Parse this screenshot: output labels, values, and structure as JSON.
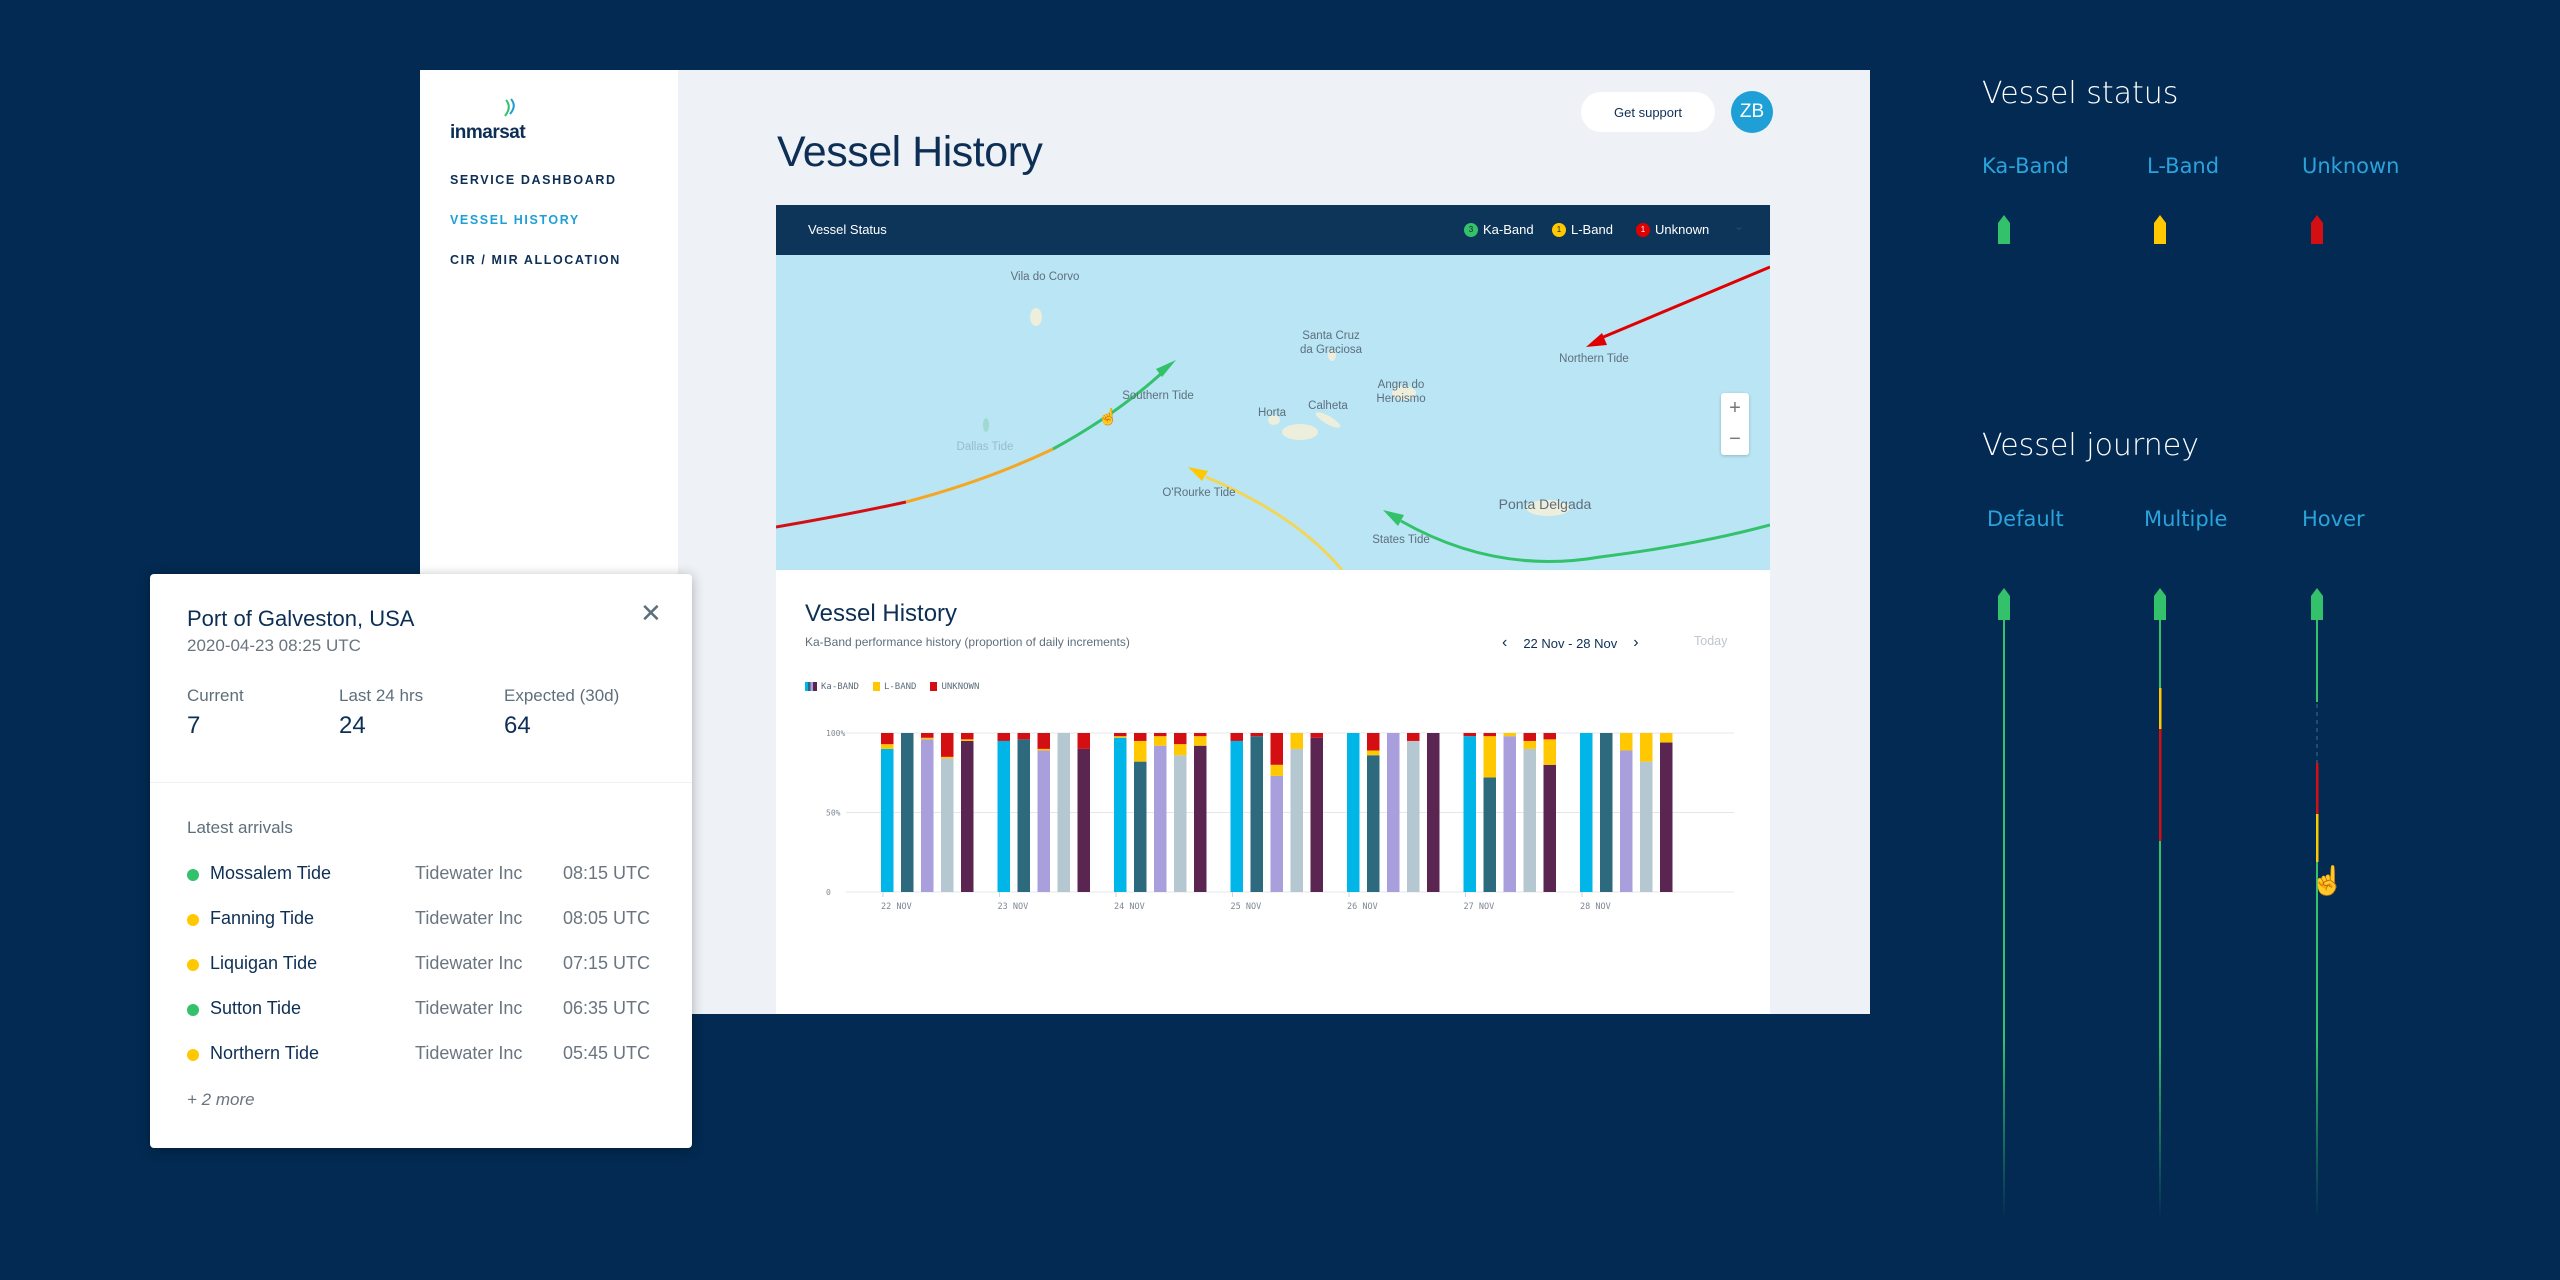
{
  "app": {
    "logo": "inmarsat",
    "nav": [
      {
        "label": "SERVICE DASHBOARD",
        "active": false
      },
      {
        "label": "VESSEL HISTORY",
        "active": true
      },
      {
        "label": "CIR / MIR ALLOCATION",
        "active": false
      }
    ],
    "support_label": "Get support",
    "avatar_initials": "ZB",
    "page_title": "Vessel History"
  },
  "map": {
    "header": "Vessel Status",
    "status": [
      {
        "label": "Ka-Band",
        "count": "3",
        "color": "#33c16b"
      },
      {
        "label": "L-Band",
        "count": "1",
        "color": "#ffc800"
      },
      {
        "label": "Unknown",
        "count": "1",
        "color": "#e00000"
      }
    ],
    "places": [
      "Vila do Corvo",
      "Santa Cruz",
      "da Graciosa",
      "Angra do",
      "Heroismo",
      "Calheta",
      "Horta",
      "Ponta Delgada"
    ],
    "vessels": [
      "Southern Tide",
      "Dallas Tide",
      "Northern Tide",
      "O'Rourke Tide",
      "States Tide"
    ],
    "zoom_in": "+",
    "zoom_out": "−"
  },
  "history": {
    "title": "Vessel History",
    "subtitle": "Ka-Band performance history (proportion of daily increments)",
    "range": "22 Nov - 28 Nov",
    "prev": "‹",
    "next": "›",
    "today": "Today",
    "legend": [
      "Ka-BAND",
      "L-BAND",
      "UNKNOWN"
    ]
  },
  "chart_data": {
    "type": "bar",
    "stacked": true,
    "categories": [
      "22 NOV",
      "23 NOV",
      "24 NOV",
      "25 NOV",
      "26 NOV",
      "27 NOV",
      "28 NOV"
    ],
    "yticks": [
      "100%",
      "50%",
      "0"
    ],
    "ylim": [
      0,
      100
    ],
    "grid": true,
    "band_colors": {
      "Ka-BAND": "vessel color",
      "L-BAND": "#ffc800",
      "UNKNOWN": "#d40f14"
    },
    "series": [
      {
        "name": "SOUTHERN TIDE",
        "color": "#00b5e8",
        "ka": [
          90,
          95,
          97,
          95,
          100,
          98,
          100
        ],
        "l": [
          3,
          0,
          1,
          0,
          0,
          0,
          0
        ],
        "unknown": [
          7,
          5,
          2,
          5,
          0,
          2,
          0
        ]
      },
      {
        "name": "O'ROURKE TIDE",
        "color": "#2d6a7d",
        "ka": [
          100,
          96,
          82,
          98,
          86,
          72,
          100
        ],
        "l": [
          0,
          0,
          13,
          0,
          3,
          26,
          0
        ],
        "unknown": [
          0,
          4,
          5,
          2,
          11,
          2,
          0
        ]
      },
      {
        "name": "STATES TIDE",
        "color": "#a89fdc",
        "ka": [
          96,
          89,
          92,
          73,
          100,
          98,
          89
        ],
        "l": [
          1,
          1,
          6,
          7,
          0,
          2,
          11
        ],
        "unknown": [
          3,
          10,
          2,
          20,
          0,
          0,
          0
        ]
      },
      {
        "name": "DALLAS TIDE",
        "color": "#b5c8d2",
        "ka": [
          84,
          100,
          86,
          90,
          95,
          90,
          82
        ],
        "l": [
          1,
          0,
          7,
          10,
          0,
          5,
          18
        ],
        "unknown": [
          15,
          0,
          7,
          0,
          5,
          5,
          0
        ]
      },
      {
        "name": "NORTHERN TIDE",
        "color": "#5a2550",
        "ka": [
          95,
          90,
          92,
          97,
          100,
          80,
          94
        ],
        "l": [
          1,
          0,
          6,
          0,
          0,
          16,
          6
        ],
        "unknown": [
          4,
          10,
          2,
          3,
          0,
          4,
          0
        ]
      }
    ]
  },
  "popup": {
    "title": "Port of Galveston, USA",
    "datetime": "2020-04-23 08:25 UTC",
    "stats": [
      {
        "label": "Current",
        "value": "7"
      },
      {
        "label": "Last 24 hrs",
        "value": "24"
      },
      {
        "label": "Expected (30d)",
        "value": "64"
      }
    ],
    "arrivals_label": "Latest arrivals",
    "arrivals": [
      {
        "name": "Mossalem Tide",
        "company": "Tidewater Inc",
        "time": "08:15 UTC",
        "color": "#33c16b"
      },
      {
        "name": "Fanning Tide",
        "company": "Tidewater Inc",
        "time": "08:05 UTC",
        "color": "#ffc800"
      },
      {
        "name": "Liquigan Tide",
        "company": "Tidewater Inc",
        "time": "07:15 UTC",
        "color": "#ffc800"
      },
      {
        "name": "Sutton Tide",
        "company": "Tidewater Inc",
        "time": "06:35 UTC",
        "color": "#33c16b"
      },
      {
        "name": "Northern Tide",
        "company": "Tidewater Inc",
        "time": "05:45 UTC",
        "color": "#ffc800"
      }
    ],
    "more": "+ 2 more"
  },
  "legend_panel": {
    "status_title": "Vessel status",
    "status": [
      {
        "label": "Ka-Band",
        "color": "#33c16b"
      },
      {
        "label": "L-Band",
        "color": "#ffc800"
      },
      {
        "label": "Unknown",
        "color": "#d40f14"
      }
    ],
    "journey_title": "Vessel journey",
    "journey": [
      "Default",
      "Multiple",
      "Hover"
    ]
  }
}
